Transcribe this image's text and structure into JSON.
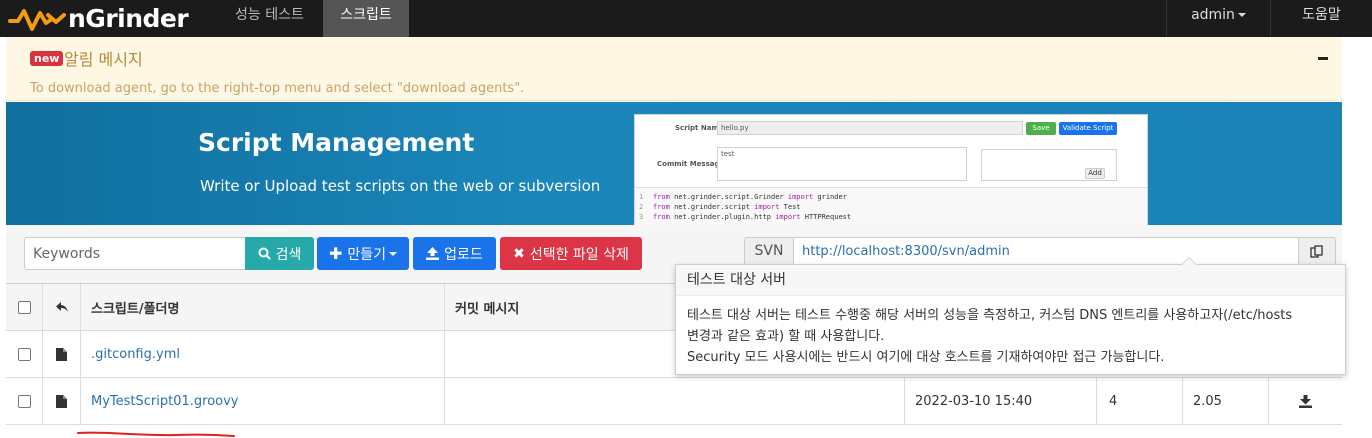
{
  "nav": {
    "brand": "nGrinder",
    "items": [
      {
        "label": "성능 테스트",
        "active": false
      },
      {
        "label": "스크립트",
        "active": true
      }
    ],
    "user": "admin",
    "help": "도움말"
  },
  "alert": {
    "badge": "new",
    "title": "알림 메시지",
    "message": "To download agent, go to the right-top menu and select \"download agents\"."
  },
  "banner": {
    "title": "Script Management",
    "subtitle": "Write or Upload test scripts on the web or subversion",
    "preview": {
      "script_name_label": "Script Name",
      "script_name_value": "hello.py",
      "save": "Save",
      "validate": "Validate Script",
      "commit_label": "Commit Message",
      "commit_value": "test",
      "add": "Add",
      "code_lines": [
        {
          "n": "1",
          "a": "from",
          "b": " net.grinder.script.Grinder ",
          "c": "import",
          "d": " grinder"
        },
        {
          "n": "2",
          "a": "from",
          "b": " net.grinder.script ",
          "c": "import",
          "d": " Test"
        },
        {
          "n": "3",
          "a": "from",
          "b": " net.grinder.plugin.http ",
          "c": "import",
          "d": " HTTPRequest"
        }
      ]
    }
  },
  "toolbar": {
    "search_placeholder": "Keywords",
    "search": "검색",
    "create": "만들기",
    "upload": "업로드",
    "delete": "선택한 파일 삭제",
    "svn_label": "SVN",
    "svn_url": "http://localhost:8300/svn/admin"
  },
  "table": {
    "headers": {
      "name": "스크립트/폴더명",
      "commit": "커밋 메시지"
    },
    "rows": [
      {
        "name": ".gitconfig.yml",
        "date": "",
        "revision": "",
        "size": ""
      },
      {
        "name": "MyTestScript01.groovy",
        "date": "2022-03-10 15:40",
        "revision": "4",
        "size": "2.05"
      }
    ]
  },
  "tooltip": {
    "title": "테스트 대상 서버",
    "line1": "테스트 대상 서버는 테스트 수행중 해당 서버의 성능을 측정하고, 커스텀 DNS 엔트리를 사용하고자(/etc/hosts",
    "line2": "변경과 같은 효과) 할 때 사용합니다.",
    "line3": "Security 모드 사용시에는 반드시 여기에 대상 호스트를 기재하여야만 접근 가능합니다."
  },
  "colors": {
    "search": "#27a9a9",
    "create": "#1a73e8",
    "upload": "#1a73e8",
    "delete": "#dc3545",
    "badge": "#d9333f"
  }
}
